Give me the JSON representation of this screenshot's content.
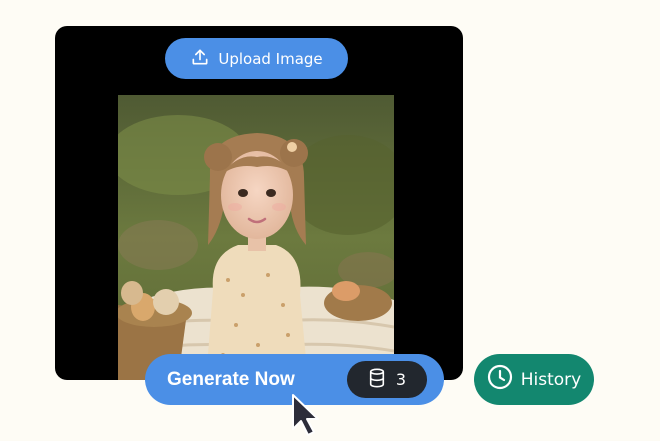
{
  "upload": {
    "label": "Upload Image",
    "icon": "upload-icon"
  },
  "generate": {
    "label": "Generate Now",
    "credits_icon": "database-icon",
    "credits": "3"
  },
  "history": {
    "label": "History",
    "icon": "clock-icon"
  },
  "photo": {
    "subject": "portrait of a young girl sitting on a blanket in grass with a basket of eggs"
  },
  "colors": {
    "page_background": "#fefcf5",
    "stage_background": "#000000",
    "primary_blue": "#4b8fe6",
    "history_green": "#13876f",
    "credits_pill": "#22272e"
  }
}
